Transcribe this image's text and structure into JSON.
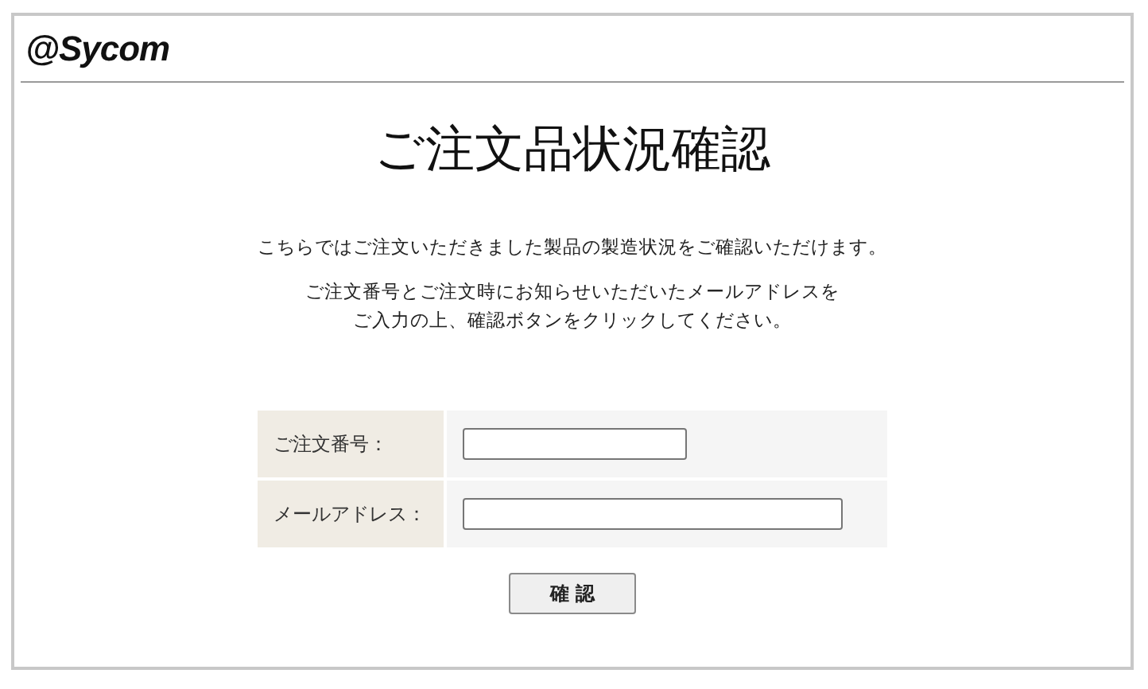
{
  "header": {
    "logo": "@Sycom"
  },
  "title": "ご注文品状況確認",
  "intro": [
    [
      "こちらではご注文いただきました製品の製造状況をご確認いただけます。"
    ],
    [
      "ご注文番号とご注文時にお知らせいただいたメールアドレスを",
      "ご入力の上、確認ボタンをクリックしてください。"
    ]
  ],
  "form": {
    "fields": [
      {
        "label": "ご注文番号：",
        "kind": "short"
      },
      {
        "label": "メールアドレス：",
        "kind": "long"
      }
    ],
    "submit": "確 認"
  }
}
